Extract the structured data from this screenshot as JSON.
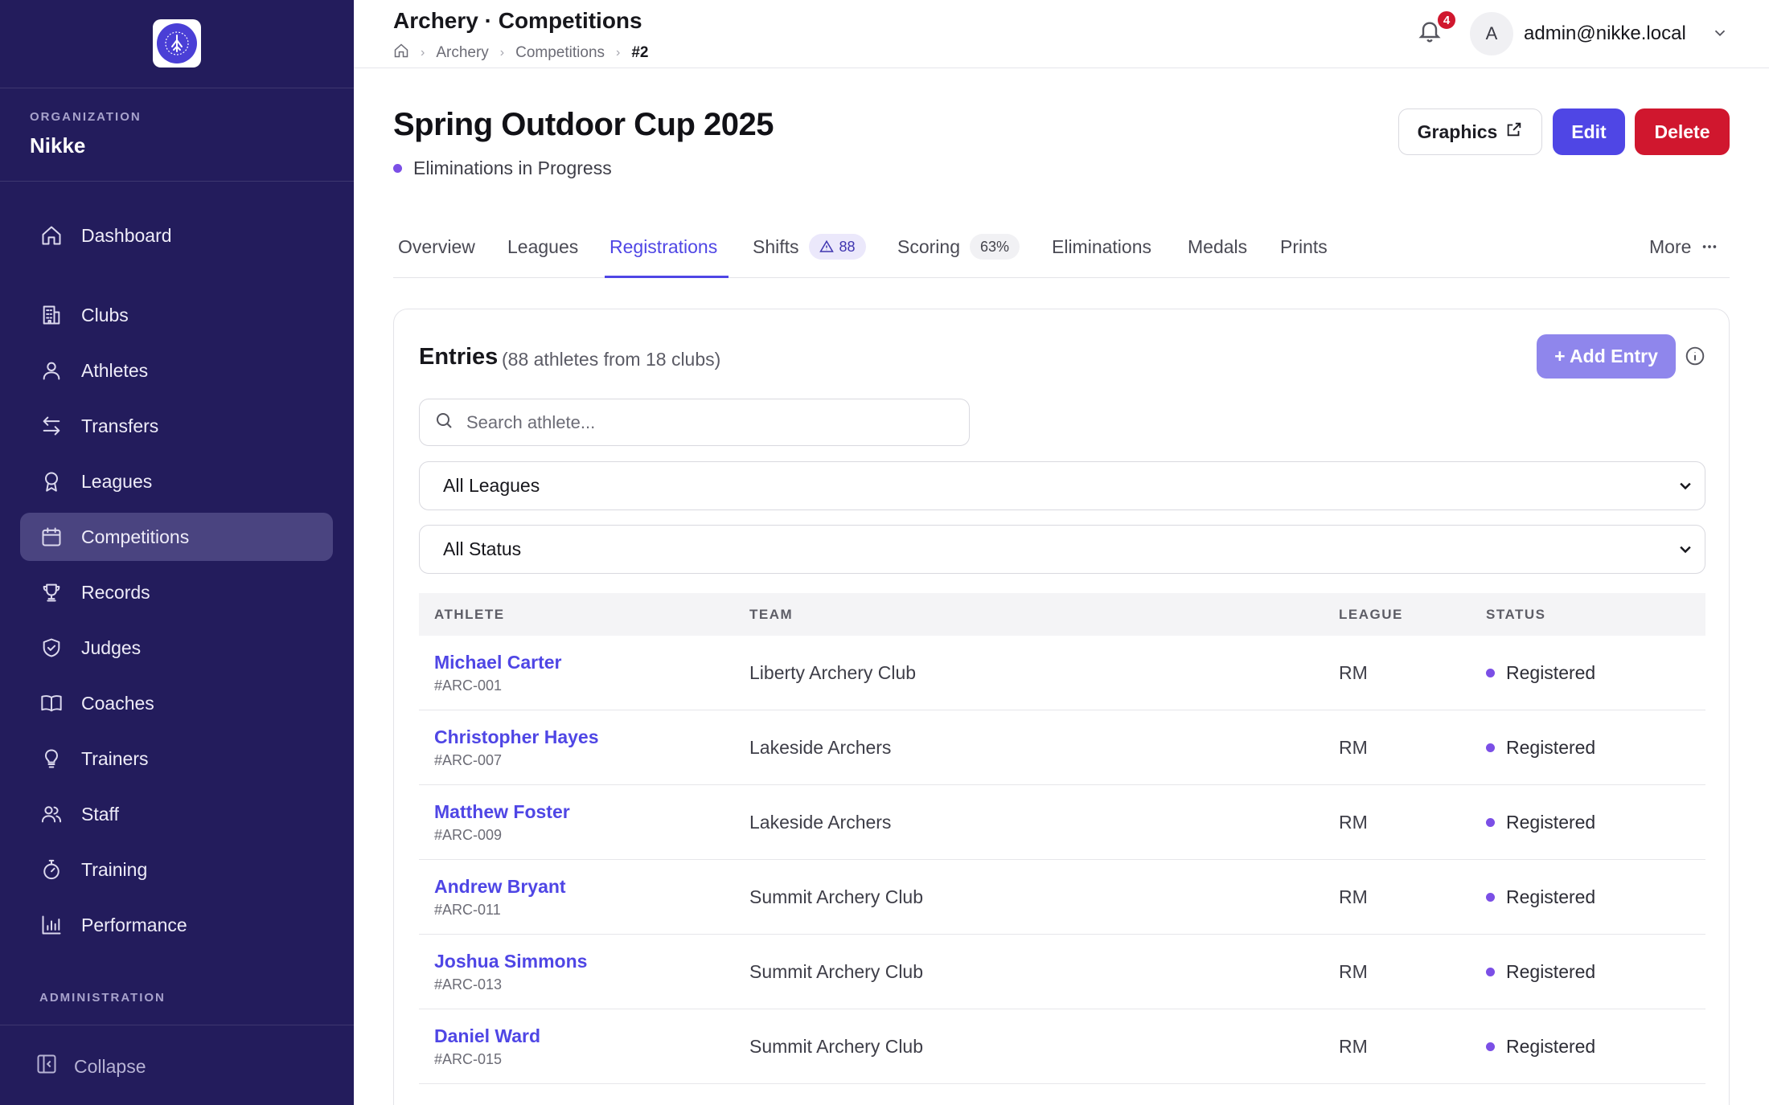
{
  "sidebar": {
    "org_label": "ORGANIZATION",
    "org_name": "Nikke",
    "items": [
      {
        "label": "Dashboard",
        "icon": "home-icon"
      },
      {
        "label": "Clubs",
        "icon": "building-icon"
      },
      {
        "label": "Athletes",
        "icon": "user-icon"
      },
      {
        "label": "Transfers",
        "icon": "arrows-icon"
      },
      {
        "label": "Leagues",
        "icon": "award-icon"
      },
      {
        "label": "Competitions",
        "icon": "calendar-icon"
      },
      {
        "label": "Records",
        "icon": "trophy-icon"
      },
      {
        "label": "Judges",
        "icon": "shield-check-icon"
      },
      {
        "label": "Coaches",
        "icon": "book-icon"
      },
      {
        "label": "Trainers",
        "icon": "lightbulb-icon"
      },
      {
        "label": "Staff",
        "icon": "users-icon"
      },
      {
        "label": "Training",
        "icon": "stopwatch-icon"
      },
      {
        "label": "Performance",
        "icon": "bar-chart-icon"
      }
    ],
    "active_item": "Competitions",
    "admin_label": "ADMINISTRATION",
    "collapse_label": "Collapse"
  },
  "topbar": {
    "title": "Archery · Competitions",
    "breadcrumb": [
      "Archery",
      "Competitions",
      "#2"
    ],
    "notification_count": "4",
    "avatar_letter": "A",
    "user_email": "admin@nikke.local"
  },
  "header": {
    "title": "Spring Outdoor Cup 2025",
    "status": "Eliminations in Progress",
    "graphics_label": "Graphics",
    "edit_label": "Edit",
    "delete_label": "Delete"
  },
  "tabs": {
    "overview": "Overview",
    "leagues": "Leagues",
    "registrations": "Registrations",
    "shifts": "Shifts",
    "shifts_badge": "88",
    "scoring": "Scoring",
    "scoring_badge": "63%",
    "eliminations": "Eliminations",
    "medals": "Medals",
    "prints": "Prints",
    "more": "More",
    "active": "Registrations"
  },
  "entries": {
    "title": "Entries",
    "subtitle": "(88 athletes from 18 clubs)",
    "add_label": "+ Add Entry",
    "search_placeholder": "Search athlete...",
    "league_filter": "All Leagues",
    "status_filter": "All Status",
    "columns": [
      "ATHLETE",
      "TEAM",
      "LEAGUE",
      "STATUS"
    ],
    "rows": [
      {
        "name": "Michael Carter",
        "id": "#ARC-001",
        "team": "Liberty Archery Club",
        "league": "RM",
        "status": "Registered"
      },
      {
        "name": "Christopher Hayes",
        "id": "#ARC-007",
        "team": "Lakeside Archers",
        "league": "RM",
        "status": "Registered"
      },
      {
        "name": "Matthew Foster",
        "id": "#ARC-009",
        "team": "Lakeside Archers",
        "league": "RM",
        "status": "Registered"
      },
      {
        "name": "Andrew Bryant",
        "id": "#ARC-011",
        "team": "Summit Archery Club",
        "league": "RM",
        "status": "Registered"
      },
      {
        "name": "Joshua Simmons",
        "id": "#ARC-013",
        "team": "Summit Archery Club",
        "league": "RM",
        "status": "Registered"
      },
      {
        "name": "Daniel Ward",
        "id": "#ARC-015",
        "team": "Summit Archery Club",
        "league": "RM",
        "status": "Registered"
      }
    ]
  },
  "colors": {
    "sidebar_bg": "#231c5c",
    "accent": "#4f46e5",
    "danger": "#d0172e",
    "status_dot": "#7b4fe6"
  }
}
